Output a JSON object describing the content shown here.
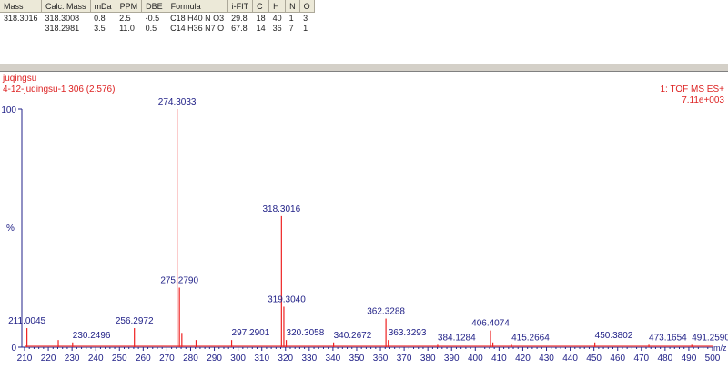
{
  "table": {
    "headers": [
      "Mass",
      "Calc. Mass",
      "mDa",
      "PPM",
      "DBE",
      "Formula",
      "i-FIT",
      "C",
      "H",
      "N",
      "O"
    ],
    "rows": [
      [
        "318.3016",
        "318.3008",
        "0.8",
        "2.5",
        "-0.5",
        "C18 H40 N O3",
        "29.8",
        "18",
        "40",
        "1",
        "3"
      ],
      [
        "",
        "318.2981",
        "3.5",
        "11.0",
        "0.5",
        "C14 H36 N7 O",
        "67.8",
        "14",
        "36",
        "7",
        "1"
      ]
    ]
  },
  "chart_data": {
    "type": "bar",
    "title": "juqingsu",
    "subtitle": "4-12-juqingsu-1 306 (2.576)",
    "scan_info": "1: TOF MS ES+",
    "intensity": "7.11e+003",
    "xlabel": "m/z",
    "ylabel": "%",
    "xlim": [
      210,
      500
    ],
    "ylim": [
      0,
      100
    ],
    "xticks": [
      210,
      220,
      230,
      240,
      250,
      260,
      270,
      280,
      290,
      300,
      310,
      320,
      330,
      340,
      350,
      360,
      370,
      380,
      390,
      400,
      410,
      420,
      430,
      440,
      450,
      460,
      470,
      480,
      490,
      500
    ],
    "yticks": [
      "0",
      "100"
    ],
    "peaks": [
      {
        "mz": 211.0045,
        "rel": 8,
        "label": "211.0045"
      },
      {
        "mz": 224.2,
        "rel": 3
      },
      {
        "mz": 230.2496,
        "rel": 2,
        "label": "230.2496"
      },
      {
        "mz": 256.2972,
        "rel": 8,
        "label": "256.2972"
      },
      {
        "mz": 274.3033,
        "rel": 100,
        "label": "274.3033"
      },
      {
        "mz": 275.279,
        "rel": 25,
        "label": "275.2790"
      },
      {
        "mz": 276.3,
        "rel": 6
      },
      {
        "mz": 282.3,
        "rel": 3
      },
      {
        "mz": 297.2901,
        "rel": 3,
        "label": "297.2901"
      },
      {
        "mz": 318.3016,
        "rel": 55,
        "label": "318.3016"
      },
      {
        "mz": 319.304,
        "rel": 17,
        "label": "319.3040"
      },
      {
        "mz": 320.3058,
        "rel": 3,
        "label": "320.3058"
      },
      {
        "mz": 340.2672,
        "rel": 2,
        "label": "340.2672"
      },
      {
        "mz": 362.3288,
        "rel": 12,
        "label": "362.3288"
      },
      {
        "mz": 363.3293,
        "rel": 3,
        "label": "363.3293"
      },
      {
        "mz": 384.1284,
        "rel": 1,
        "label": "384.1284"
      },
      {
        "mz": 406.4074,
        "rel": 7,
        "label": "406.4074"
      },
      {
        "mz": 407.4,
        "rel": 2
      },
      {
        "mz": 415.2664,
        "rel": 1,
        "label": "415.2664"
      },
      {
        "mz": 450.3802,
        "rel": 2,
        "label": "450.3802"
      },
      {
        "mz": 473.1654,
        "rel": 1,
        "label": "473.1654"
      },
      {
        "mz": 491.259,
        "rel": 1,
        "label": "491.2590"
      }
    ]
  }
}
